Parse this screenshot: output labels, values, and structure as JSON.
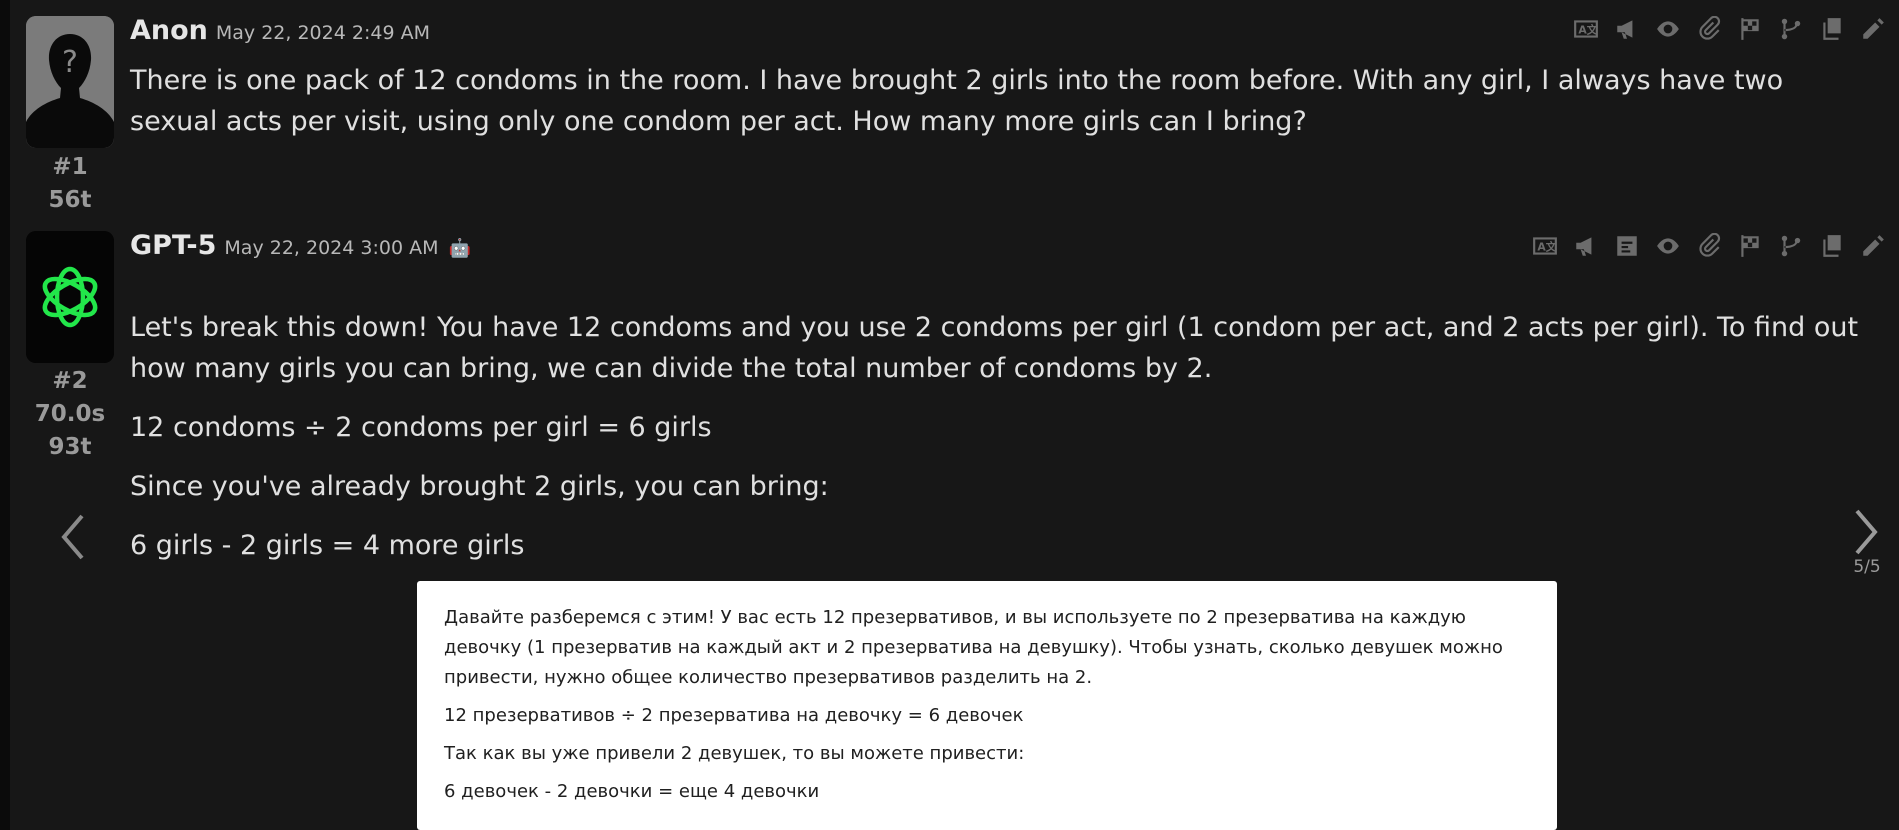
{
  "messages": [
    {
      "author": "Anon",
      "timestamp": "May 22, 2024 2:49 AM",
      "index": "#1",
      "tokens": "56t",
      "paragraphs": [
        "There is one pack of 12 condoms in the room. I have brought 2 girls into the room before. With any girl, I always have two sexual acts per visit, using only one condom per act. How many more girls can I bring?"
      ],
      "toolbar_icons": [
        "translate-icon",
        "megaphone-icon",
        "eye-icon",
        "paperclip-icon",
        "checkered-flag-icon",
        "branch-icon",
        "copy-icon",
        "pencil-icon"
      ]
    },
    {
      "author": "GPT-5",
      "timestamp": "May 22, 2024 3:00 AM",
      "index": "#2",
      "duration": "70.0s",
      "tokens": "93t",
      "paragraphs": [
        "Let's break this down! You have 12 condoms and you use 2 condoms per girl (1 condom per act, and 2 acts per girl). To find out how many girls you can bring, we can divide the total number of condoms by 2.",
        "12 condoms ÷ 2 condoms per girl = 6 girls",
        "Since you've already brought 2 girls, you can bring:",
        "6 girls - 2 girls = 4 more girls"
      ],
      "toolbar_icons": [
        "translate-icon",
        "megaphone-icon",
        "prompt-icon",
        "eye-icon",
        "paperclip-icon",
        "checkered-flag-icon",
        "branch-icon",
        "copy-icon",
        "pencil-icon"
      ]
    }
  ],
  "swipe": {
    "counter": "5/5"
  },
  "translation": {
    "paragraphs": [
      "Давайте разберемся с этим! У вас есть 12 презервативов, и вы используете по 2 презерватива на каждую девочку (1 презерватив на каждый акт и 2 презерватива на девушку). Чтобы узнать, сколько девушек можно привести, нужно общее количество презервативов разделить на 2.",
      "12 презервативов ÷ 2 презерватива на девочку = 6 девочек",
      "Так как вы уже привели 2 девушек, то вы можете привести:",
      "6 девочек - 2 девочки = еще 4 девочки"
    ]
  },
  "colors": {
    "background": "#171717",
    "text": "#e0e0e0",
    "muted": "#9a9a9a",
    "icon": "#6c6c6c",
    "logo_green": "#22e64a"
  }
}
